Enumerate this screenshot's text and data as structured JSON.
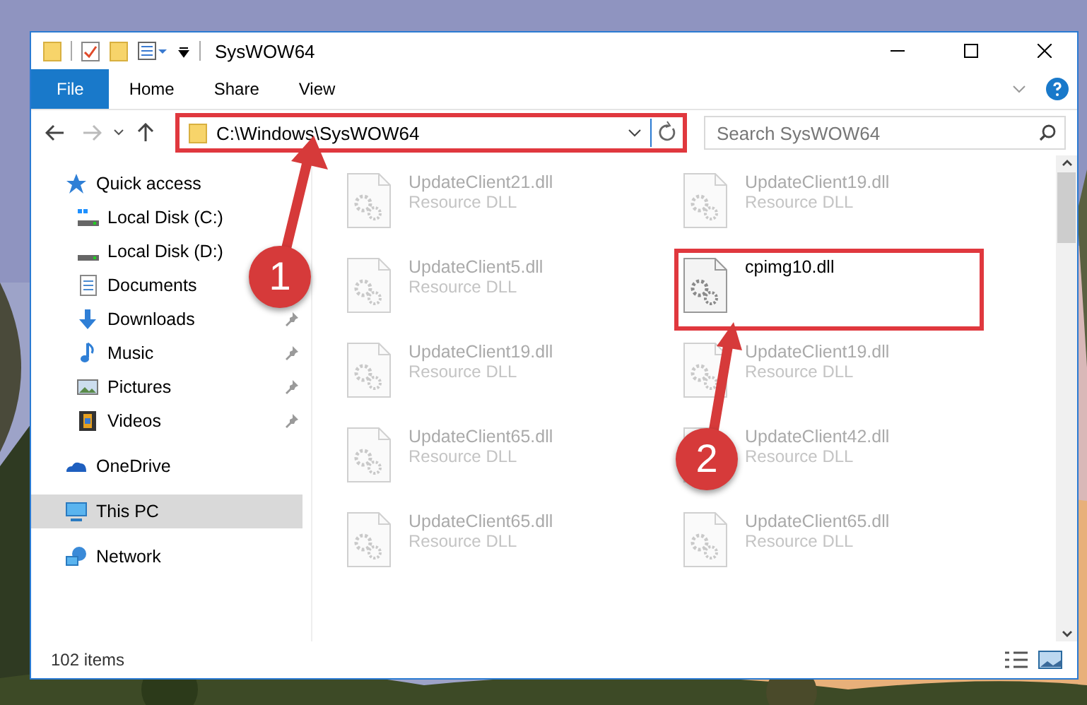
{
  "window": {
    "title": "SysWOW64"
  },
  "ribbon_tabs": [
    {
      "label": "File",
      "selected": true
    },
    {
      "label": "Home",
      "selected": false
    },
    {
      "label": "Share",
      "selected": false
    },
    {
      "label": "View",
      "selected": false
    }
  ],
  "address_bar": {
    "path": "C:\\Windows\\SysWOW64",
    "highlighted": true
  },
  "search": {
    "placeholder": "Search SysWOW64"
  },
  "sidebar": {
    "items": [
      {
        "label": "Quick access",
        "kind": "star",
        "selected": false,
        "children": [
          {
            "label": "Local Disk (C:)",
            "kind": "drive-c",
            "pinned": false,
            "selected": false
          },
          {
            "label": "Local Disk (D:)",
            "kind": "drive",
            "pinned": false,
            "selected": false
          },
          {
            "label": "Documents",
            "kind": "documents",
            "pinned": false,
            "selected": false
          },
          {
            "label": "Downloads",
            "kind": "downloads",
            "pinned": true,
            "selected": false
          },
          {
            "label": "Music",
            "kind": "music",
            "pinned": true,
            "selected": false
          },
          {
            "label": "Pictures",
            "kind": "pictures",
            "pinned": true,
            "selected": false
          },
          {
            "label": "Videos",
            "kind": "videos",
            "pinned": true,
            "selected": false
          }
        ]
      },
      {
        "label": "OneDrive",
        "kind": "cloud",
        "selected": false
      },
      {
        "label": "This PC",
        "kind": "pc",
        "selected": true
      },
      {
        "label": "Network",
        "kind": "network",
        "selected": false
      }
    ]
  },
  "files": [
    {
      "name": "UpdateClient21.dll",
      "type": "Resource DLL",
      "blurred": true,
      "highlighted": false
    },
    {
      "name": "UpdateClient19.dll",
      "type": "Resource DLL",
      "blurred": true,
      "highlighted": false
    },
    {
      "name": "UpdateClient5.dll",
      "type": "Resource DLL",
      "blurred": true,
      "highlighted": false
    },
    {
      "name": "cpimg10.dll",
      "blurred": false,
      "highlighted": true
    },
    {
      "name": "UpdateClient19.dll",
      "type": "Resource DLL",
      "blurred": true,
      "highlighted": false
    },
    {
      "name": "UpdateClient19.dll",
      "type": "Resource DLL",
      "blurred": true,
      "highlighted": false
    },
    {
      "name": "UpdateClient65.dll",
      "type": "Resource DLL",
      "blurred": true,
      "highlighted": false
    },
    {
      "name": "UpdateClient42.dll",
      "type": "Resource DLL",
      "blurred": true,
      "highlighted": false
    },
    {
      "name": "UpdateClient65.dll",
      "type": "Resource DLL",
      "blurred": true,
      "highlighted": false
    },
    {
      "name": "UpdateClient65.dll",
      "type": "Resource DLL",
      "blurred": true,
      "highlighted": false
    }
  ],
  "status_bar": {
    "item_count": "102 items"
  },
  "callouts": [
    {
      "number": "1"
    },
    {
      "number": "2"
    }
  ]
}
